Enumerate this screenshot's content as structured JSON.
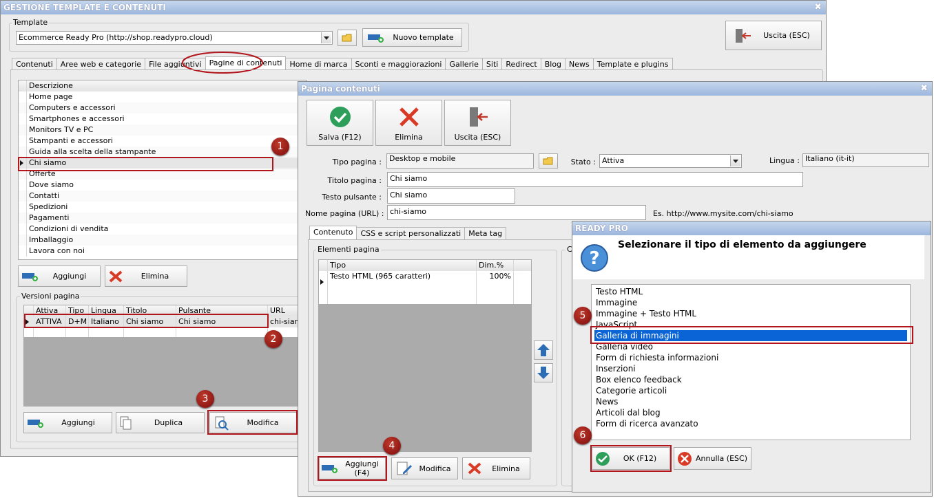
{
  "main_window": {
    "title": "GESTIONE TEMPLATE E CONTENUTI",
    "close_glyph": "✖",
    "template_group_label": "Template",
    "template_value": "Ecommerce Ready Pro (http://shop.readypro.cloud)",
    "new_template_label": "Nuovo template",
    "exit_label": "Uscita (ESC)",
    "tabs": [
      "Contenuti",
      "Aree web e categorie",
      "File aggiuntivi",
      "Pagine di contenuti",
      "Home di marca",
      "Sconti e maggiorazioni",
      "Gallerie",
      "Siti",
      "Redirect",
      "Blog",
      "News",
      "Template e plugins"
    ],
    "pages_grid": {
      "header": "Descrizione",
      "rows": [
        "Home page",
        "Computers e accessori",
        "Smartphones e accessori",
        "Monitors TV e PC",
        "Stampanti e accessori",
        "Guida alla scelta della stampante",
        "Chi siamo",
        "Offerte",
        "Dove siamo",
        "Contatti",
        "Spedizioni",
        "Pagamenti",
        "Condizioni di vendita",
        "Imballaggio",
        "Lavora con noi"
      ],
      "selected_row": "Chi siamo"
    },
    "add_label": "Aggiungi",
    "delete_label": "Elimina",
    "versions_group_label": "Versioni pagina",
    "versions_grid": {
      "headers": [
        "Attiva",
        "Tipo",
        "Lingua",
        "Titolo",
        "Pulsante",
        "URL"
      ],
      "row": [
        "ATTIVA",
        "D+M",
        "Italiano",
        "Chi siamo",
        "Chi siamo",
        "chi-siamo"
      ]
    },
    "v_add_label": "Aggiungi",
    "v_duplicate_label": "Duplica",
    "v_edit_label": "Modifica"
  },
  "page_window": {
    "title": "Pagina contenuti",
    "close_glyph": "✖",
    "save_label": "Salva (F12)",
    "delete_label": "Elimina",
    "exit_label": "Uscita (ESC)",
    "type_label": "Tipo pagina :",
    "type_value": "Desktop e mobile",
    "state_label": "Stato :",
    "state_value": "Attiva",
    "language_label": "Lingua :",
    "language_value": "Italiano (it-it)",
    "title_label": "Titolo pagina :",
    "title_value": "Chi siamo",
    "button_text_label": "Testo pulsante :",
    "button_text_value": "Chi siamo",
    "url_label": "Nome pagina (URL) :",
    "url_value": "chi-siamo",
    "url_example": "Es. http://www.mysite.com/chi-siamo",
    "tabs": [
      "Contenuto",
      "CSS e script personalizzati",
      "Meta tag"
    ],
    "elements_group_label": "Elementi pagina",
    "second_group_label": "C",
    "elements_grid": {
      "headers": [
        "Tipo",
        "Dim.%"
      ],
      "row": [
        "Testo HTML (965 caratteri)",
        "100%"
      ]
    },
    "add_label": "Aggiungi (F4)",
    "edit_label": "Modifica"
  },
  "dialog": {
    "title": "READY PRO",
    "prompt": "Selezionare il tipo di elemento da aggiungere",
    "items": [
      "Testo HTML",
      "Immagine",
      "Immagine + Testo HTML",
      "JavaScript",
      "Galleria di immagini",
      "Galleria video",
      "Form di richiesta informazioni",
      "Inserzioni",
      "Box elenco feedback",
      "Categorie articoli",
      "News",
      "Articoli dal blog",
      "Form di ricerca avanzato"
    ],
    "selected_item": "Galleria di immagini",
    "ok_label": "OK (F12)",
    "cancel_label": "Annulla (ESC)"
  },
  "annotations": {
    "badges": [
      "1",
      "2",
      "3",
      "4",
      "5",
      "6"
    ],
    "highlight_color": "#b2161c"
  },
  "colors": {
    "selection": "#0a64d6",
    "title_blue": "#a9c1e2",
    "accent_red": "#c0392b",
    "accent_green": "#2e9e5b"
  }
}
